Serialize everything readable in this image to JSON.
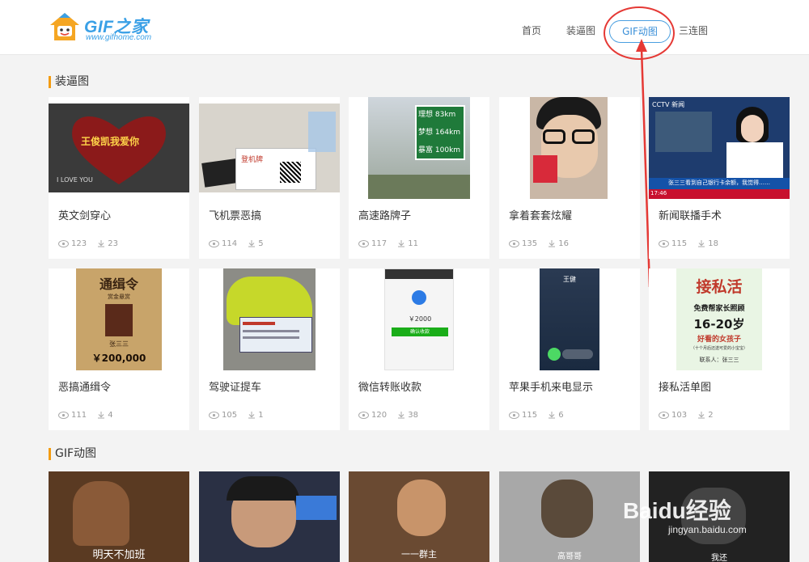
{
  "header": {
    "logo_title": "GIF之家",
    "logo_url": "www.gifhome.com",
    "nav": [
      {
        "label": "首页"
      },
      {
        "label": "装逼图"
      },
      {
        "label": "GIF动图"
      },
      {
        "label": "三连图"
      }
    ]
  },
  "sections": {
    "zhuangbi": {
      "title": "装逼图"
    },
    "gif": {
      "title": "GIF动图"
    }
  },
  "cards": [
    {
      "title": "英文剑穿心",
      "views": "123",
      "downloads": "23",
      "thumb_text_1": "王俊凯我爱你",
      "thumb_text_2": "I LOVE YOU"
    },
    {
      "title": "飞机票恶搞",
      "views": "114",
      "downloads": "5",
      "thumb_text_1": "登机牌"
    },
    {
      "title": "高速路牌子",
      "views": "117",
      "downloads": "11",
      "thumb_text_1": "理想",
      "thumb_text_2": "83km",
      "thumb_text_3": "梦想",
      "thumb_text_4": "164km",
      "thumb_text_5": "暴富",
      "thumb_text_6": "100km"
    },
    {
      "title": "拿着套套炫耀",
      "views": "135",
      "downloads": "16"
    },
    {
      "title": "新闻联播手术",
      "views": "115",
      "downloads": "18",
      "thumb_text_1": "CCTV 新闻",
      "thumb_text_2": "张三三看到自己银行卡余额，我觉得……",
      "thumb_text_3": "17:46"
    },
    {
      "title": "恶搞通缉令",
      "views": "111",
      "downloads": "4",
      "thumb_text_1": "通缉令",
      "thumb_text_2": "赏金悬赏",
      "thumb_text_3": "张三三",
      "thumb_text_4": "￥200,000"
    },
    {
      "title": "驾驶证提车",
      "views": "105",
      "downloads": "1"
    },
    {
      "title": "微信转账收款",
      "views": "120",
      "downloads": "38",
      "thumb_text_1": "￥2000",
      "thumb_text_2": "确认收款"
    },
    {
      "title": "苹果手机来电显示",
      "views": "115",
      "downloads": "6",
      "thumb_text_1": "王健"
    },
    {
      "title": "接私活单图",
      "views": "103",
      "downloads": "2",
      "thumb_text_1": "接私活",
      "thumb_text_2": "免费帮家长照顾",
      "thumb_text_3": "16-20岁",
      "thumb_text_4": "好看的女孩子",
      "thumb_text_5": "（十个月后还送可爱的小宝宝）",
      "thumb_text_6": "联系人：张三三"
    }
  ],
  "gifs": [
    {
      "caption": "明天不加班"
    },
    {
      "caption": ""
    },
    {
      "caption": "一一群主"
    },
    {
      "caption": "高哥哥"
    },
    {
      "caption": "我还"
    }
  ],
  "watermark": {
    "text": "Baidu经验",
    "url": "jingyan.baidu.com"
  },
  "colors": {
    "accent": "#3aa0e6",
    "highlight_ring": "#e53935",
    "section_bar": "#f39c12"
  }
}
